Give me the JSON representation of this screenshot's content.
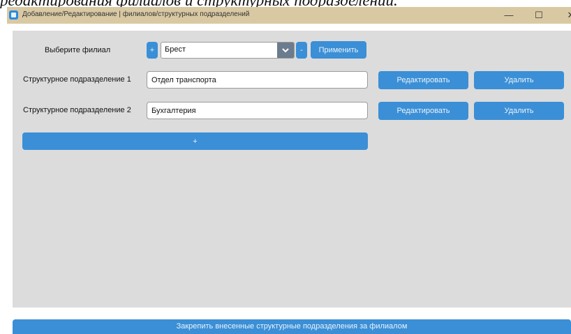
{
  "document": {
    "caption": "редактирования филиалов и структурных подразделений."
  },
  "window": {
    "title": "Добавление/Редактирование | филиалов/структурных подразделений",
    "controls": {
      "minimize": "—",
      "maximize": "☐",
      "close": "✕"
    }
  },
  "branch": {
    "label": "Выберите филиал",
    "add_label": "+",
    "selected": "Брест",
    "remove_label": "-",
    "apply_label": "Применить"
  },
  "departments": [
    {
      "label": "Структурное подразделение 1",
      "value": "Отдел транспорта",
      "edit_label": "Редактировать",
      "delete_label": "Удалить"
    },
    {
      "label": "Структурное подразделение 2",
      "value": "Бухгалтерия",
      "edit_label": "Редактировать",
      "delete_label": "Удалить"
    }
  ],
  "add_department_label": "+",
  "commit_label": "Закрепить внесенные структурные подразделения за филиалом",
  "colors": {
    "accent": "#3b8fd6",
    "titlebar": "#d9c9a3",
    "panel": "#dcdcdc"
  }
}
